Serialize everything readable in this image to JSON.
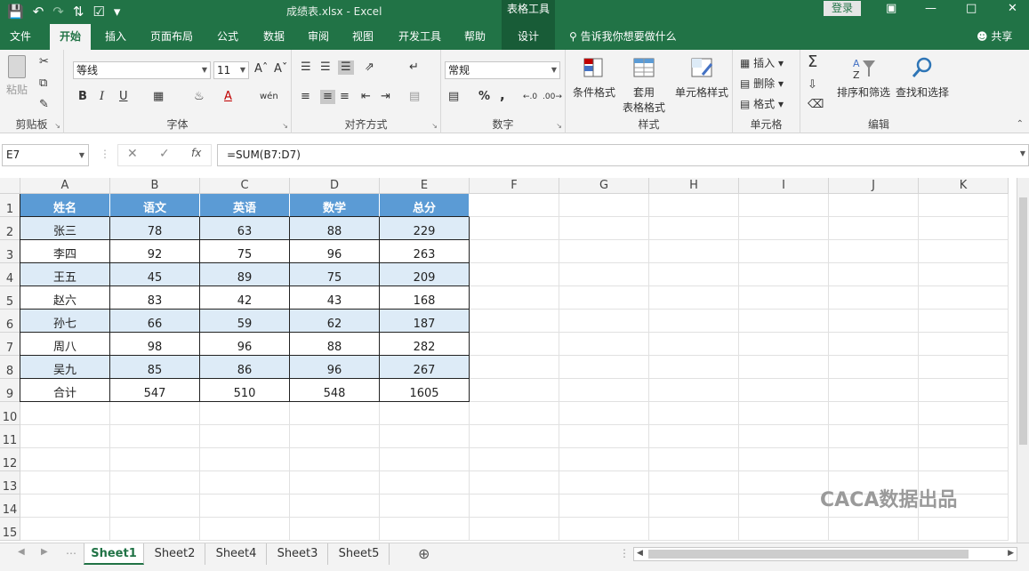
{
  "title": {
    "filename": "成绩表.xlsx",
    "separator": "-",
    "app": "Excel",
    "table_tools": "表格工具",
    "login": "登录"
  },
  "tabs": [
    "文件",
    "开始",
    "插入",
    "页面布局",
    "公式",
    "数据",
    "审阅",
    "视图",
    "开发工具",
    "帮助",
    "设计"
  ],
  "tell_me": "告诉我你想要做什么",
  "share": "共享",
  "ribbon": {
    "clipboard": {
      "label": "剪贴板",
      "paste": "粘贴"
    },
    "font": {
      "label": "字体",
      "name": "等线",
      "size": "11",
      "bold": "B",
      "italic": "I",
      "underline": "U"
    },
    "alignment": {
      "label": "对齐方式"
    },
    "number": {
      "label": "数字",
      "format": "常规",
      "percent": "%",
      "comma": ","
    },
    "styles": {
      "label": "样式",
      "conditional": "条件格式",
      "as_table": "套用",
      "as_table2": "表格格式",
      "cell_styles": "单元格样式"
    },
    "cells": {
      "label": "单元格",
      "insert": "插入",
      "delete": "删除",
      "format": "格式"
    },
    "editing": {
      "label": "编辑",
      "sort": "排序和筛选",
      "find": "查找和选择"
    }
  },
  "formula_bar": {
    "name_box": "E7",
    "formula": "=SUM(B7:D7)",
    "fx": "fx"
  },
  "columns": [
    "A",
    "B",
    "C",
    "D",
    "E",
    "F",
    "G",
    "H",
    "I",
    "J",
    "K"
  ],
  "rows": [
    "1",
    "2",
    "3",
    "4",
    "5",
    "6",
    "7",
    "8",
    "9",
    "10",
    "11",
    "12",
    "13",
    "14",
    "15"
  ],
  "table": {
    "header": [
      "姓名",
      "语文",
      "英语",
      "数学",
      "总分"
    ],
    "rows": [
      [
        "张三",
        "78",
        "63",
        "88",
        "229"
      ],
      [
        "李四",
        "92",
        "75",
        "96",
        "263"
      ],
      [
        "王五",
        "45",
        "89",
        "75",
        "209"
      ],
      [
        "赵六",
        "83",
        "42",
        "43",
        "168"
      ],
      [
        "孙七",
        "66",
        "59",
        "62",
        "187"
      ],
      [
        "周八",
        "98",
        "96",
        "88",
        "282"
      ],
      [
        "吴九",
        "85",
        "86",
        "96",
        "267"
      ],
      [
        "合计",
        "547",
        "510",
        "548",
        "1605"
      ]
    ]
  },
  "sheets": [
    "Sheet1",
    "Sheet2",
    "Sheet4",
    "Sheet3",
    "Sheet5"
  ],
  "active_sheet": "Sheet1",
  "watermark": "CACA数据出品",
  "colors": {
    "brand": "#217346",
    "header_fill": "#5b9bd5",
    "band_fill": "#ddebf7"
  }
}
